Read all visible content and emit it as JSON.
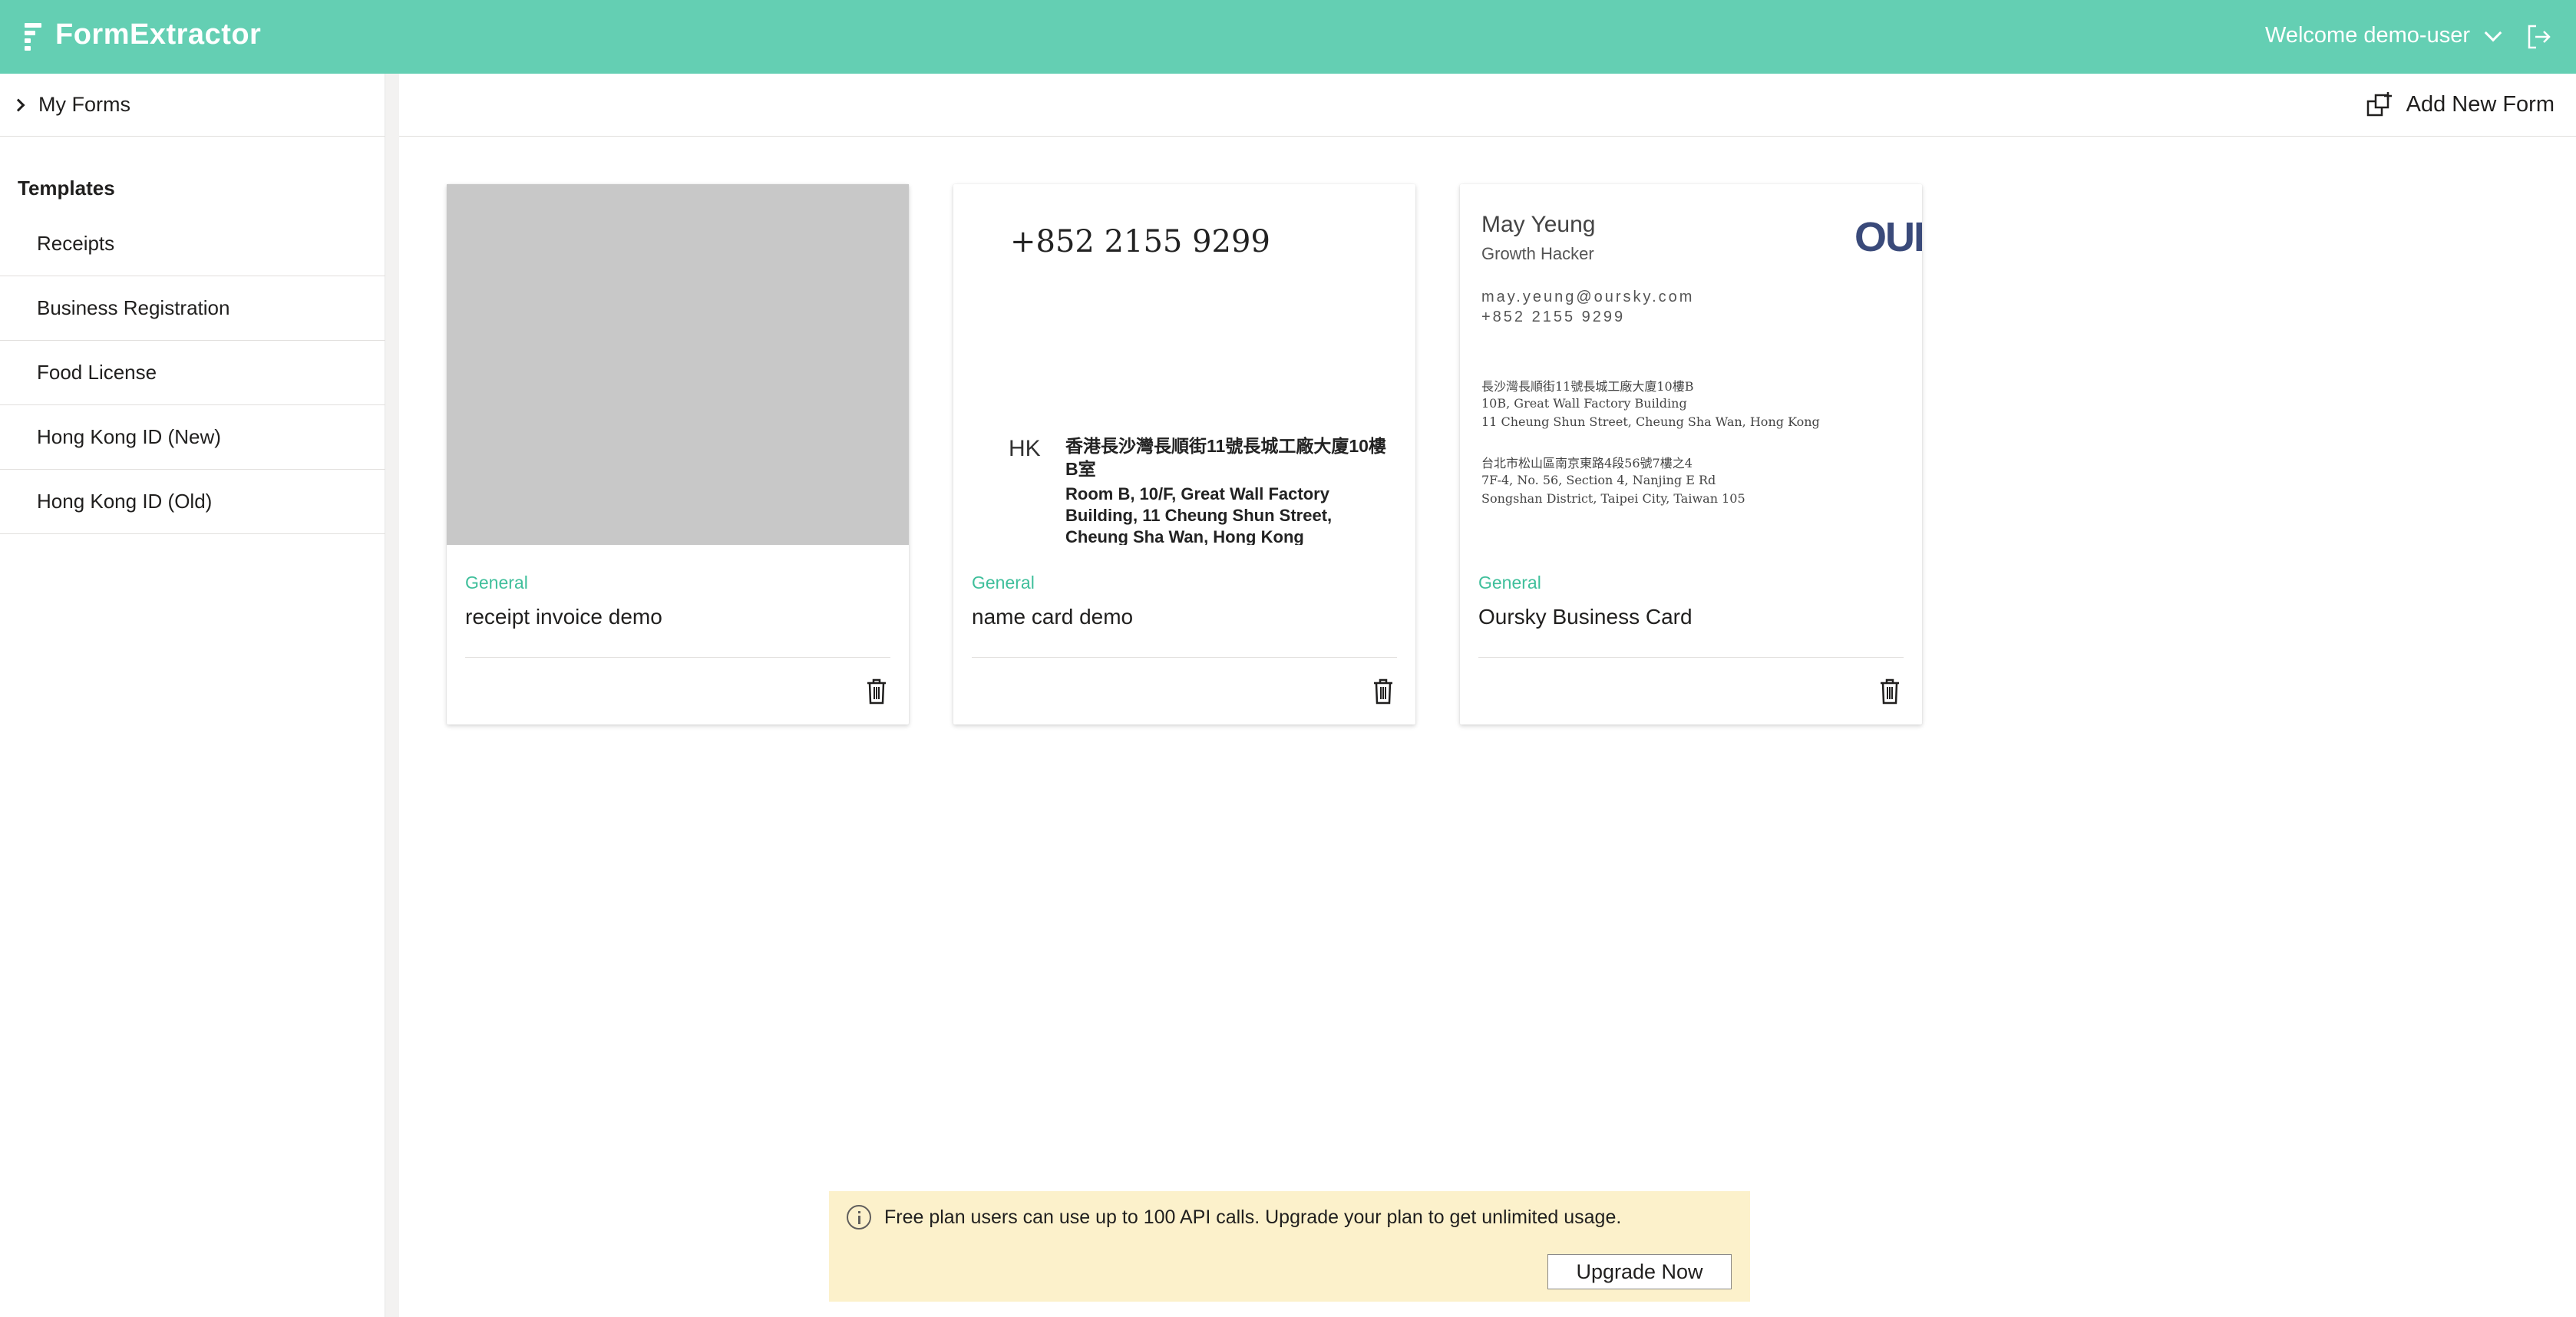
{
  "header": {
    "brand": "FormExtractor",
    "welcome": "Welcome demo-user"
  },
  "sidebar": {
    "my_forms": "My Forms",
    "templates_title": "Templates",
    "templates": [
      "Receipts",
      "Business Registration",
      "Food License",
      "Hong Kong ID (New)",
      "Hong Kong ID (Old)"
    ]
  },
  "toolbar": {
    "add_new_form": "Add New Form"
  },
  "cards": [
    {
      "category": "General",
      "name": "receipt invoice demo"
    },
    {
      "category": "General",
      "name": "name card demo",
      "preview": {
        "phone": "+852 2155 9299",
        "region": "HK",
        "address_cn": "香港長沙灣長順街11號長城工廠大廈10樓B室",
        "address_en": "Room B, 10/F, Great Wall Factory Building, 11 Cheung Shun Street, Cheung Sha Wan, Hong Kong"
      }
    },
    {
      "category": "General",
      "name": "Oursky Business Card",
      "preview": {
        "person": "May Yeung",
        "role": "Growth Hacker",
        "logo": "OUI",
        "email": "may.yeung@oursky.com",
        "phone": "+852 2155 9299",
        "hk_cn": "長沙灣長順街11號長城工廠大廈10樓B",
        "hk_line1": "10B, Great Wall Factory Building",
        "hk_line2": "11 Cheung Shun Street, Cheung Sha Wan, Hong Kong",
        "tw_cn": "台北市松山區南京東路4段56號7樓之4",
        "tw_line1": "7F-4, No. 56, Section 4, Nanjing E Rd",
        "tw_line2": "Songshan District, Taipei City, Taiwan 105"
      }
    }
  ],
  "notice": {
    "message": "Free plan users can use up to 100 API calls. Upgrade your plan to get unlimited usage.",
    "button": "Upgrade Now"
  },
  "colors": {
    "header_bg": "#64cfb3",
    "accent": "#3fbf9b",
    "notice_bg": "#fcf1cb"
  },
  "icons": [
    "logo-icon",
    "chevron-down-icon",
    "logout-icon",
    "chevron-right-icon",
    "add-form-icon",
    "trash-icon",
    "info-icon"
  ]
}
